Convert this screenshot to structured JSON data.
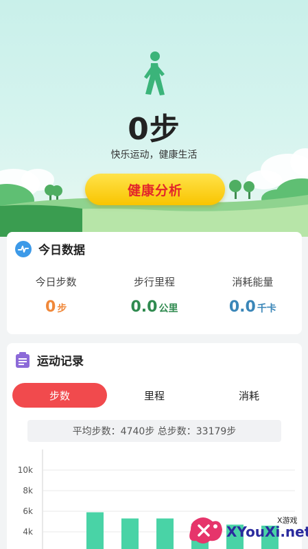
{
  "hero": {
    "steps_value": "0步",
    "slogan": "快乐运动，健康生活",
    "analysis_button": "健康分析"
  },
  "today": {
    "title": "今日数据",
    "stats": [
      {
        "label": "今日步数",
        "value": "0",
        "unit": "步",
        "color": "#f0883a"
      },
      {
        "label": "步行里程",
        "value": "0.0",
        "unit": "公里",
        "color": "#2f8a4f"
      },
      {
        "label": "消耗能量",
        "value": "0.0",
        "unit": "千卡",
        "color": "#3a86b8"
      }
    ]
  },
  "records": {
    "title": "运动记录",
    "tabs": [
      {
        "label": "步数",
        "active": true
      },
      {
        "label": "里程",
        "active": false
      },
      {
        "label": "消耗",
        "active": false
      }
    ],
    "summary": "平均步数：4740步 总步数：33179步"
  },
  "chart_data": {
    "type": "bar",
    "ytick_labels": [
      "10k",
      "8k",
      "6k",
      "4k"
    ],
    "ylim": [
      2000,
      10000
    ],
    "values": [
      5900,
      5300,
      5300,
      4800,
      4700,
      4600
    ],
    "bar_color": "#49d3a6"
  },
  "watermark": {
    "site": "XYouXi.net",
    "tag": "X游戏"
  },
  "colors": {
    "accent_red": "#f14a4d",
    "button_yellow": "#f9c400",
    "walker_green": "#3bb47a"
  }
}
